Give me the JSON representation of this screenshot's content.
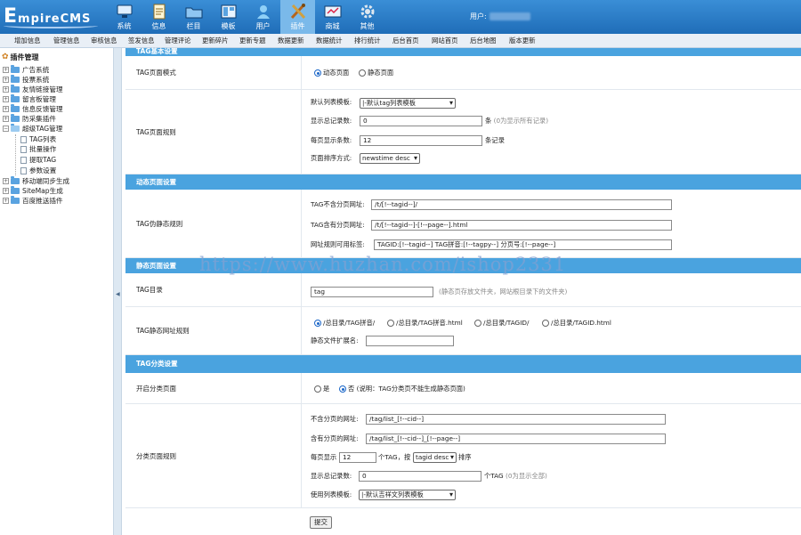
{
  "header": {
    "logo_big": "E",
    "logo_rest": "mpireCMS",
    "nav": [
      {
        "label": "系统",
        "icon": "computer-icon"
      },
      {
        "label": "信息",
        "icon": "notepad-icon"
      },
      {
        "label": "栏目",
        "icon": "folder-icon"
      },
      {
        "label": "模板",
        "icon": "template-icon"
      },
      {
        "label": "用户",
        "icon": "user-icon"
      },
      {
        "label": "插件",
        "icon": "plugin-tools-icon"
      },
      {
        "label": "商城",
        "icon": "shop-icon"
      },
      {
        "label": "其他",
        "icon": "gear-icon"
      }
    ],
    "active_nav": "插件",
    "user_label": "用户:"
  },
  "topmenu": [
    "增加信息",
    "管理信息",
    "审核信息",
    "签发信息",
    "管理评论",
    "更新碎片",
    "更新专题",
    "数据更新",
    "数据统计",
    "排行统计",
    "后台首页",
    "网站首页",
    "后台地图",
    "版本更新"
  ],
  "sidebar": {
    "root": "插件管理",
    "items": [
      "广告系统",
      "投票系统",
      "友情链接管理",
      "留言板管理",
      "信息反馈管理",
      "防采集插件",
      "超级TAG管理"
    ],
    "sub_items": [
      "TAG列表",
      "批量操作",
      "提取TAG",
      "参数设置"
    ],
    "items2": [
      "移动端同步生成",
      "SiteMap生成",
      "百度推送插件"
    ]
  },
  "sections": {
    "basic_partial": "TAG基本设置",
    "dynamic": "动态页面设置",
    "static": "静态页面设置",
    "category": "TAG分类设置"
  },
  "rows": {
    "mode": {
      "label": "TAG页面模式",
      "opt1": "动态页面",
      "opt2": "静态页面"
    },
    "rules": {
      "label": "TAG页面规则",
      "tpl_label": "默认列表模板:",
      "tpl_value": "|-默认tag列表模板",
      "count_label": "显示总记录数:",
      "count_value": "0",
      "count_unit": "条",
      "count_hint": "(0为显示所有记录)",
      "per_label": "每页显示条数:",
      "per_value": "12",
      "per_unit": "条记录",
      "sort_label": "页面排序方式:",
      "sort_value": "newstime desc"
    },
    "pseudo": {
      "label": "TAG伪静态规则",
      "nopage_label": "TAG不含分页网址:",
      "nopage_value": "/t/[!--tagid--]/",
      "page_label": "TAG含有分页网址:",
      "page_value": "/t/[!--tagid--]-[!--page--].html",
      "tags_label": "网址规则可用标签:",
      "tags_value": "TAGID:[!--tagid--]  TAG拼音:[!--tagpy--]  分页号:[!--page--]"
    },
    "dir": {
      "label": "TAG目录",
      "value": "tag",
      "hint": "(静态页存放文件夹，网站根目录下的文件夹)"
    },
    "static_rule": {
      "label": "TAG静态网址规则",
      "opt1": "/总目录/TAG拼音/",
      "opt2": "/总目录/TAG拼音.html",
      "opt3": "/总目录/TAGID/",
      "opt4": "/总目录/TAGID.html",
      "ext_label": "静态文件扩展名:"
    },
    "cat_open": {
      "label": "开启分类页面",
      "yes": "是",
      "no": "否",
      "note": "(说明：TAG分类页不能生成静态页面)"
    },
    "cat_rules": {
      "label": "分类页面规则",
      "nopage_label": "不含分页的网址:",
      "nopage_value": "/tag/list_[!--cid--]",
      "page_label": "含有分页的网址:",
      "page_value": "/tag/list_[!--cid--]_[!--page--]",
      "per_label": "每页显示",
      "per_value": "12",
      "per_mid": "个TAG，按",
      "sort_value": "tagid desc",
      "per_end": "排序",
      "count_label": "显示总记录数:",
      "count_value": "0",
      "count_unit": "个TAG",
      "count_hint": "(0为显示全部)",
      "tpl_label": "使用列表模板:",
      "tpl_value": "|-默认吉祥文列表模板"
    }
  },
  "submit_label": "提交",
  "watermark": "https://www.huzhan.com/ishop2331",
  "colors": {
    "header": "#2a7fcc",
    "section": "#4aa3df",
    "active_nav": "#7ab9ea"
  }
}
